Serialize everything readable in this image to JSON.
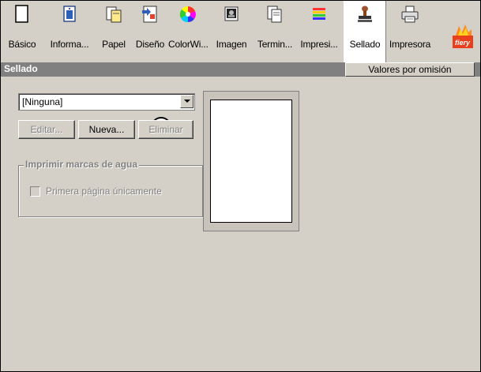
{
  "toolbar": {
    "tabs": [
      {
        "label": "Básico",
        "icon": "blank-page-icon"
      },
      {
        "label": "Informa...",
        "icon": "info-page-icon"
      },
      {
        "label": "Papel",
        "icon": "paper-icon"
      },
      {
        "label": "Diseño",
        "icon": "layout-icon"
      },
      {
        "label": "ColorWi...",
        "icon": "color-wheel-icon"
      },
      {
        "label": "Imagen",
        "icon": "image-icon"
      },
      {
        "label": "Termin...",
        "icon": "finishing-icon"
      },
      {
        "label": "Impresi...",
        "icon": "printing-icon"
      },
      {
        "label": "Sellado",
        "icon": "stamp-icon",
        "active": true
      },
      {
        "label": "Impresora",
        "icon": "printer-icon"
      }
    ],
    "logo_text": "fiery"
  },
  "header": {
    "title": "Sellado",
    "defaults_button": "Valores por omisión"
  },
  "stamp": {
    "select_value": "[Ninguna]",
    "callout": "1",
    "buttons": {
      "edit": "Editar...",
      "new": "Nueva...",
      "delete": "Eliminar"
    },
    "watermark_group": {
      "legend": "Imprimir marcas de agua",
      "first_page_only": "Primera página únicamente"
    }
  }
}
